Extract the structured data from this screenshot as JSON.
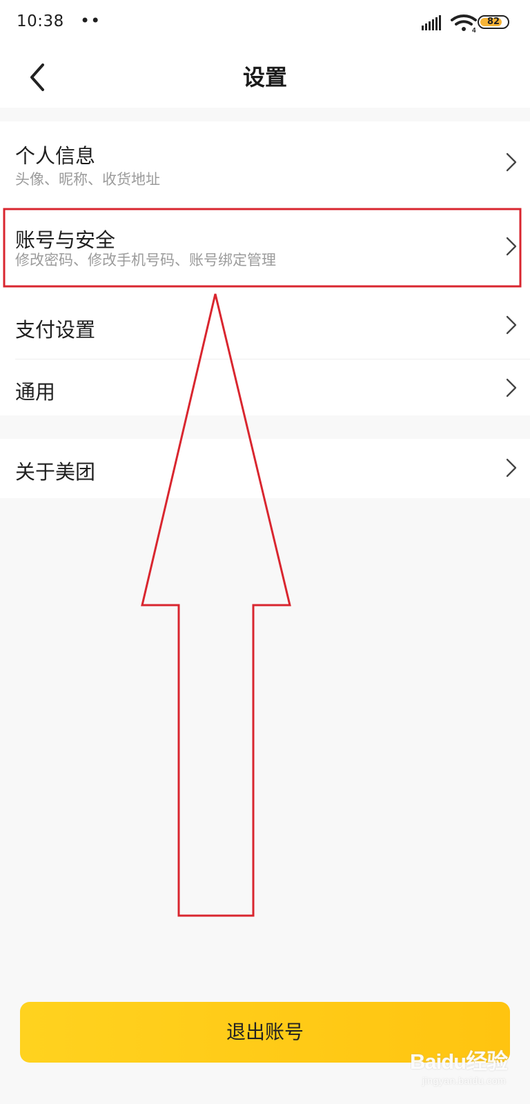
{
  "status_bar": {
    "time": "10:38",
    "dots": "••",
    "signal_icon": "signal-icon",
    "wifi_icon": "wifi-icon",
    "wifi_badge": "4",
    "battery_level": 82,
    "battery_text": "82",
    "battery_color": "#f6b436"
  },
  "header": {
    "title": "设置",
    "back_icon": "chevron-left-icon"
  },
  "settings": {
    "personal": {
      "title": "个人信息",
      "subtitle": "头像、昵称、收货地址"
    },
    "account": {
      "title": "账号与安全",
      "subtitle": "修改密码、修改手机号码、账号绑定管理"
    },
    "payment": {
      "title": "支付设置"
    },
    "general": {
      "title": "通用"
    },
    "about": {
      "title": "关于美团"
    }
  },
  "footer": {
    "logout_label": "退出账号",
    "accent_color": "#ffc410"
  },
  "annotation": {
    "highlight_color": "#d9262f",
    "shape_icon": "arrow-up-icon"
  },
  "watermark": {
    "main": "Baidu经验",
    "sub": "jingyan.baidu.com"
  }
}
